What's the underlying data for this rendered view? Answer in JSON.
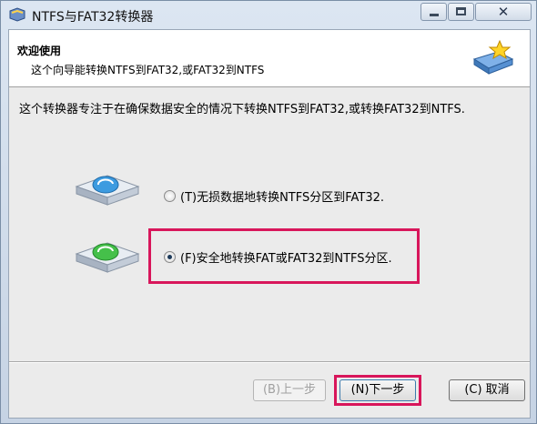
{
  "window": {
    "title": "NTFS与FAT32转换器",
    "close_glyph": "✕"
  },
  "header": {
    "title": "欢迎使用",
    "subtitle": "这个向导能转换NTFS到FAT32,或FAT32到NTFS",
    "icon": "drive-star-icon"
  },
  "main": {
    "intro": "这个转换器专注于在确保数据安全的情况下转换NTFS到FAT32,或转换FAT32到NTFS.",
    "options": [
      {
        "label": "(T)无损数据地转换NTFS分区到FAT32.",
        "checked": false,
        "icon": "drive-blue-arrow-icon"
      },
      {
        "label": "(F)安全地转换FAT或FAT32到NTFS分区.",
        "checked": true,
        "icon": "drive-green-arrow-icon"
      }
    ]
  },
  "buttons": {
    "back": "(B)上一步",
    "next": "(N)下一步",
    "cancel": "(C) 取消"
  },
  "colors": {
    "highlight": "#d8165b",
    "accent": "#3d7bad"
  }
}
